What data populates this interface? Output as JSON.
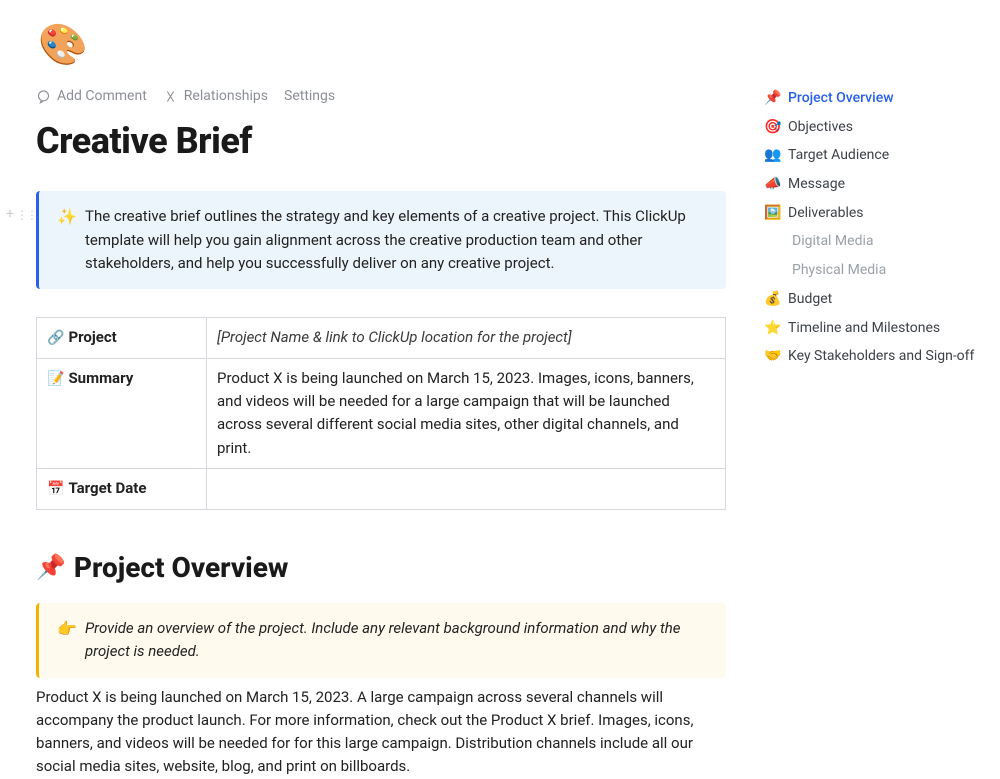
{
  "page_icon": "🎨",
  "toolbar": {
    "add_comment": "Add Comment",
    "relationships": "Relationships",
    "settings": "Settings"
  },
  "title": "Creative Brief",
  "intro_callout": {
    "emoji": "✨",
    "text": "The creative brief outlines the strategy and key elements of a creative project. This ClickUp template will help you gain alignment across the creative production team and other stakeholders, and help you successfully deliver on any creative project."
  },
  "info_table": {
    "rows": [
      {
        "emoji": "🔗",
        "label": "Project",
        "value": "[Project Name & link to ClickUp location for the project]",
        "italic": true
      },
      {
        "emoji": "📝",
        "label": "Summary",
        "value": "Product X is being launched on March 15, 2023. Images, icons, banners, and videos will be needed for a large campaign that will be launched across several different social media sites, other digital channels, and print.",
        "italic": false
      },
      {
        "emoji": "📅",
        "label": "Target Date",
        "value": "",
        "italic": false
      }
    ]
  },
  "section_overview": {
    "emoji": "📌",
    "title": "Project Overview",
    "hint_emoji": "👉",
    "hint_text": "Provide an overview of the project. Include any relevant background information and why the project is needed.",
    "body": "Product X is being launched on March 15, 2023. A large campaign across several channels will accompany the product launch. For more information, check out the Product X brief. Images, icons, banners, and videos will be needed for for this large campaign. Distribution channels include all our social media sites, website, blog, and print on billboards."
  },
  "toc": [
    {
      "emoji": "📌",
      "label": "Project Overview",
      "active": true
    },
    {
      "emoji": "🎯",
      "label": "Objectives"
    },
    {
      "emoji": "👥",
      "label": "Target Audience"
    },
    {
      "emoji": "📣",
      "label": "Message"
    },
    {
      "emoji": "🖼️",
      "label": "Deliverables"
    },
    {
      "label": "Digital Media",
      "sub": true
    },
    {
      "label": "Physical Media",
      "sub": true
    },
    {
      "emoji": "💰",
      "label": "Budget"
    },
    {
      "emoji": "⭐",
      "label": "Timeline and Milestones"
    },
    {
      "emoji": "🤝",
      "label": "Key Stakeholders and Sign-off"
    }
  ]
}
